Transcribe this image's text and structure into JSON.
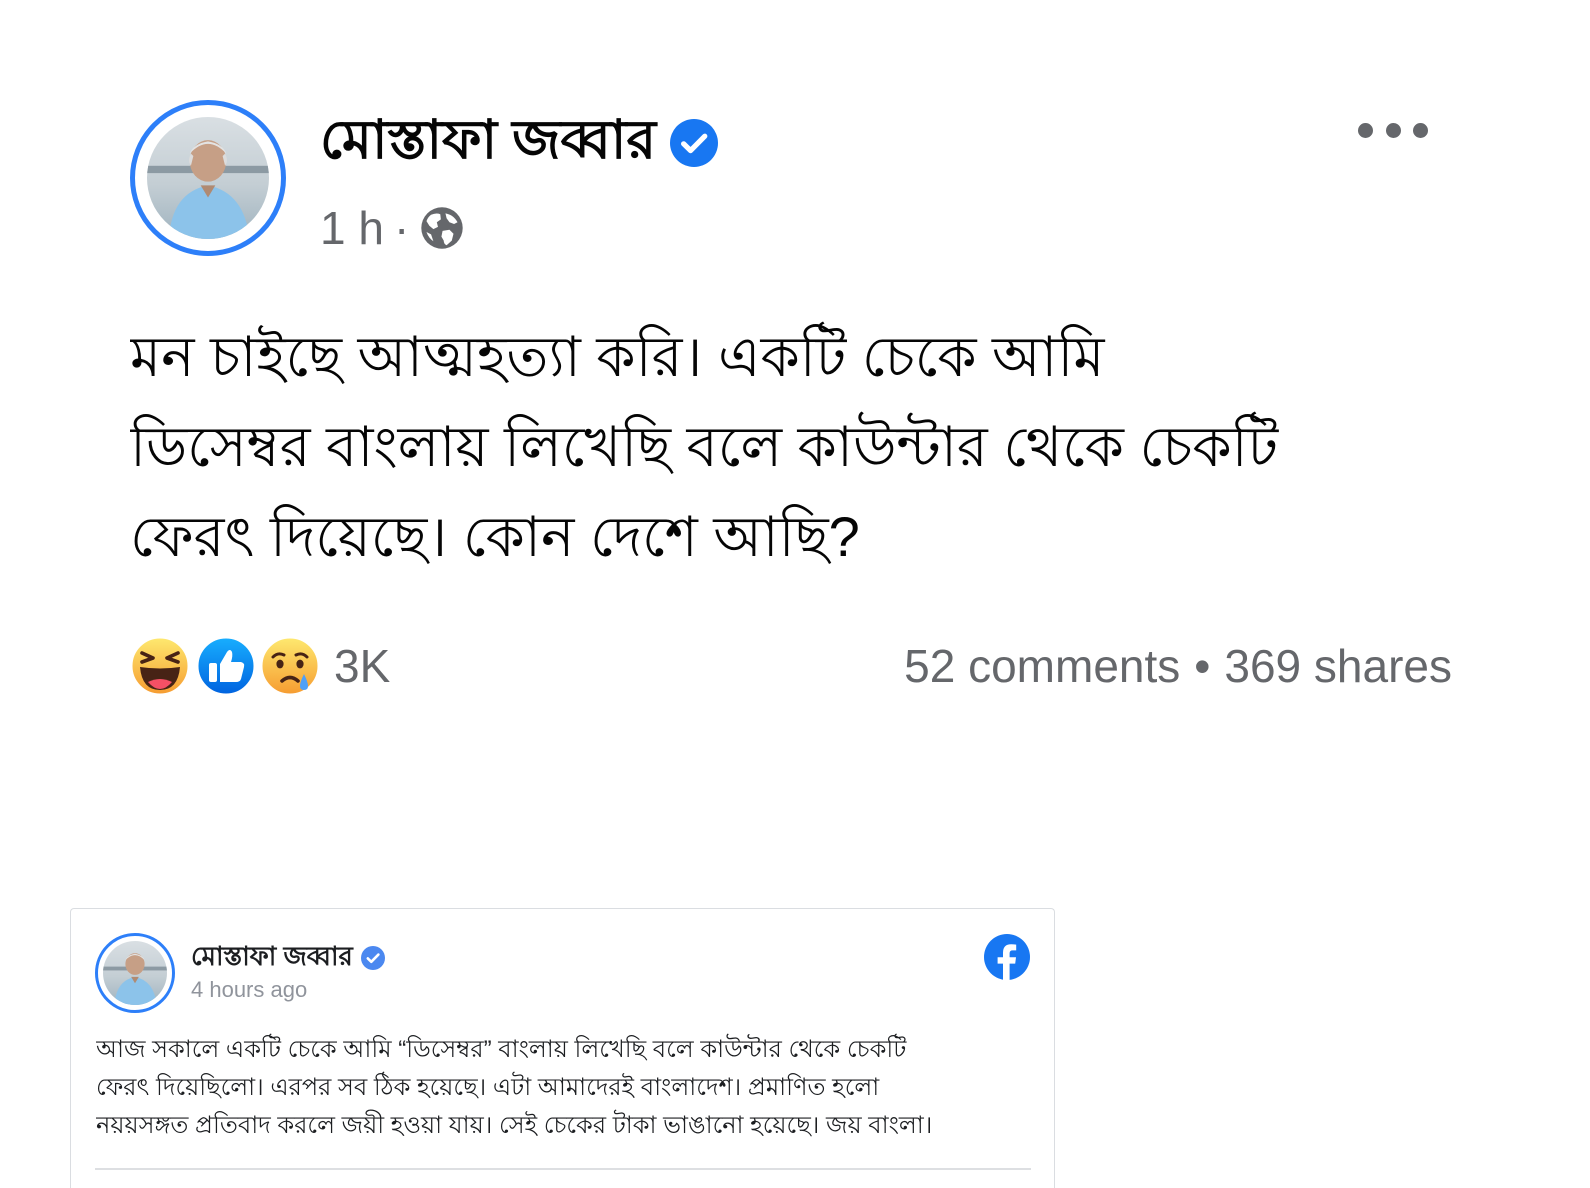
{
  "post": {
    "author": "মোস্তাফা জব্বার",
    "time": "1 h",
    "separator": "·",
    "privacy_icon": "globe-icon",
    "more_icon": "more-icon",
    "lines": [
      "মন চাইছে আত্মহত্যা করি। একটি চেকে আমি",
      "ডিসেম্বর বাংলায় লিখেছি বলে কাউন্টার থেকে চেকটি",
      "ফেরৎ দিয়েছে। কোন দেশে আছি?"
    ],
    "reactions": [
      "haha-icon",
      "like-icon",
      "sad-icon"
    ],
    "reaction_count": "3K",
    "comments": "52 comments",
    "bullet": "•",
    "shares": "369 shares"
  },
  "embed": {
    "author": "মোস্তাফা জব্বার",
    "time": "4 hours ago",
    "logo_icon": "facebook-logo-icon",
    "lines": [
      "আজ সকালে একটি চেকে আমি “ডিসেম্বর” বাংলায় লিখেছি বলে কাউন্টার থেকে চেকটি",
      "ফেরৎ দিয়েছিলো। এরপর সব ঠিক হয়েছে। এটা আমাদেরই বাংলাদেশ। প্রমাণিত হলো",
      "নয়য়সঙ্গত প্রতিবাদ করলে জয়ী হওয়া যায়। সেই চেকের টাকা ভাঙানো হয়েছে। জয় বাংলা।"
    ]
  },
  "colors": {
    "facebook_blue": "#1877f2",
    "avatar_ring": "#2d7ff9",
    "meta_grey": "#65676b",
    "text": "#050505"
  }
}
